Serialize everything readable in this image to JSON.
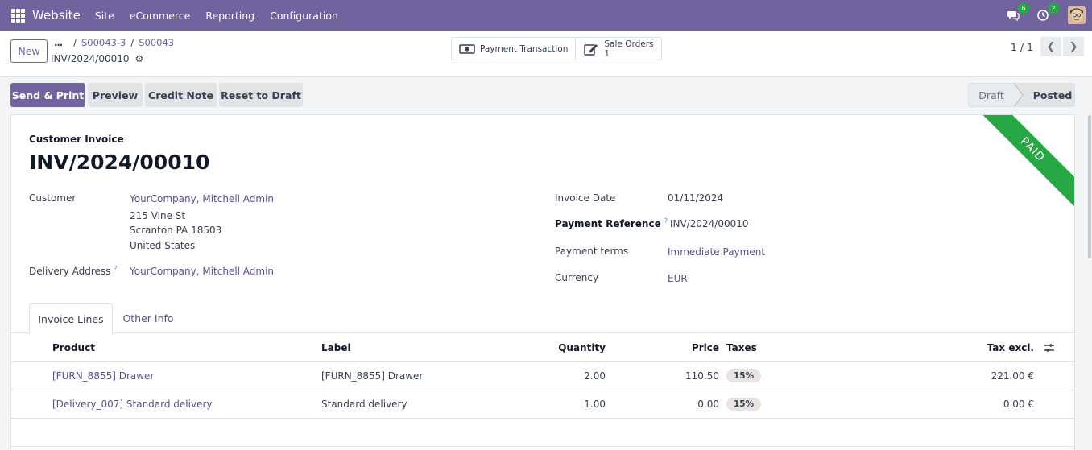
{
  "navbar": {
    "app_name": "Website",
    "menu": [
      "Site",
      "eCommerce",
      "Reporting",
      "Configuration"
    ],
    "messages_count": "6",
    "activities_count": "2",
    "accent": "#71639e"
  },
  "control_panel": {
    "new_label": "New",
    "breadcrumb_dots": "...",
    "breadcrumbs": [
      "S00043-3",
      "S00043"
    ],
    "record_name": "INV/2024/00010",
    "smart_buttons": {
      "payment_label": "Payment Transaction",
      "sale_orders_label": "Sale Orders",
      "sale_orders_count": "1"
    },
    "pager": "1 / 1"
  },
  "actions": {
    "send_print": "Send & Print",
    "preview": "Preview",
    "credit_note": "Credit Note",
    "reset_draft": "Reset to Draft"
  },
  "status": {
    "stages": [
      "Draft",
      "Posted"
    ],
    "current": "Posted"
  },
  "invoice": {
    "ribbon": "PAID",
    "doc_type": "Customer Invoice",
    "name": "INV/2024/00010",
    "customer_label": "Customer",
    "customer": "YourCompany, Mitchell Admin",
    "address": [
      "215 Vine St",
      "Scranton PA 18503",
      "United States"
    ],
    "delivery_label": "Delivery Address",
    "delivery_help": "?",
    "delivery_address": "YourCompany, Mitchell Admin",
    "invoice_date_label": "Invoice Date",
    "invoice_date": "01/11/2024",
    "payment_ref_label": "Payment Reference",
    "payment_ref_help": "?",
    "payment_ref": "INV/2024/00010",
    "payment_terms_label": "Payment terms",
    "payment_terms": "Immediate Payment",
    "currency_label": "Currency",
    "currency": "EUR"
  },
  "tabs": [
    "Invoice Lines",
    "Other Info"
  ],
  "lines": {
    "headers": {
      "product": "Product",
      "label": "Label",
      "quantity": "Quantity",
      "price": "Price",
      "taxes": "Taxes",
      "tax_excl": "Tax excl."
    },
    "rows": [
      {
        "product": "[FURN_8855] Drawer",
        "label": "[FURN_8855] Drawer",
        "quantity": "2.00",
        "price": "110.50",
        "tax": "15%",
        "subtotal": "221.00 €"
      },
      {
        "product": "[Delivery_007] Standard delivery",
        "label": "Standard delivery",
        "quantity": "1.00",
        "price": "0.00",
        "tax": "15%",
        "subtotal": "0.00 €"
      }
    ]
  }
}
